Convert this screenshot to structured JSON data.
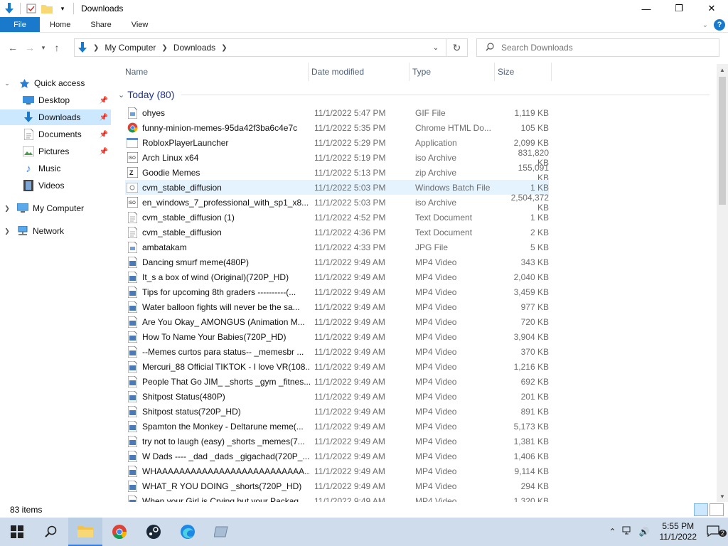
{
  "window": {
    "title": "Downloads",
    "controls": {
      "minimize": "—",
      "maximize": "❐",
      "close": "✕"
    }
  },
  "ribbon": {
    "tabs": [
      "File",
      "Home",
      "Share",
      "View"
    ],
    "help": "?"
  },
  "address": {
    "crumbs": [
      "My Computer",
      "Downloads"
    ],
    "search_placeholder": "Search Downloads"
  },
  "nav": {
    "items": [
      {
        "label": "Quick access",
        "icon": "star-icon",
        "expand": "v",
        "indent": 0,
        "pinned": false
      },
      {
        "label": "Desktop",
        "icon": "desktop-icon",
        "indent": 1,
        "pinned": true
      },
      {
        "label": "Downloads",
        "icon": "download-arrow-icon",
        "indent": 1,
        "pinned": true,
        "selected": true
      },
      {
        "label": "Documents",
        "icon": "document-icon",
        "indent": 1,
        "pinned": true
      },
      {
        "label": "Pictures",
        "icon": "pictures-icon",
        "indent": 1,
        "pinned": true
      },
      {
        "label": "Music",
        "icon": "music-icon",
        "indent": 1,
        "pinned": false
      },
      {
        "label": "Videos",
        "icon": "videos-icon",
        "indent": 1,
        "pinned": false
      },
      {
        "label": "My Computer",
        "icon": "computer-icon",
        "expand": ">",
        "indent": 0,
        "pinned": false
      },
      {
        "label": "Network",
        "icon": "network-icon",
        "expand": ">",
        "indent": 0,
        "pinned": false
      }
    ]
  },
  "columns": {
    "name": "Name",
    "date": "Date modified",
    "type": "Type",
    "size": "Size"
  },
  "group": {
    "label": "Today (80)"
  },
  "files": [
    {
      "name": "ohyes",
      "date": "11/1/2022 5:47 PM",
      "type": "GIF File",
      "size": "1,119 KB",
      "icon": "image-file-icon"
    },
    {
      "name": "funny-minion-memes-95da42f3ba6c4e7c",
      "date": "11/1/2022 5:35 PM",
      "type": "Chrome HTML Do...",
      "size": "105 KB",
      "icon": "chrome-icon"
    },
    {
      "name": "RobloxPlayerLauncher",
      "date": "11/1/2022 5:29 PM",
      "type": "Application",
      "size": "2,099 KB",
      "icon": "application-icon"
    },
    {
      "name": "Arch Linux x64",
      "date": "11/1/2022 5:19 PM",
      "type": "iso Archive",
      "size": "831,820 KB",
      "icon": "iso-archive-icon"
    },
    {
      "name": "Goodie Memes",
      "date": "11/1/2022 5:13 PM",
      "type": "zip Archive",
      "size": "155,091 KB",
      "icon": "zip-archive-icon"
    },
    {
      "name": "cvm_stable_diffusion",
      "date": "11/1/2022 5:03 PM",
      "type": "Windows Batch File",
      "size": "1 KB",
      "icon": "batch-file-icon",
      "hover": true
    },
    {
      "name": "en_windows_7_professional_with_sp1_x8...",
      "date": "11/1/2022 5:03 PM",
      "type": "iso Archive",
      "size": "2,504,372 KB",
      "icon": "iso-archive-icon"
    },
    {
      "name": "cvm_stable_diffusion (1)",
      "date": "11/1/2022 4:52 PM",
      "type": "Text Document",
      "size": "1 KB",
      "icon": "text-file-icon"
    },
    {
      "name": "cvm_stable_diffusion",
      "date": "11/1/2022 4:36 PM",
      "type": "Text Document",
      "size": "2 KB",
      "icon": "text-file-icon"
    },
    {
      "name": "ambatakam",
      "date": "11/1/2022 4:33 PM",
      "type": "JPG File",
      "size": "5 KB",
      "icon": "image-file-icon"
    },
    {
      "name": "Dancing smurf meme(480P)",
      "date": "11/1/2022 9:49 AM",
      "type": "MP4 Video",
      "size": "343 KB",
      "icon": "video-file-icon"
    },
    {
      "name": "It_s a box of wind (Original)(720P_HD)",
      "date": "11/1/2022 9:49 AM",
      "type": "MP4 Video",
      "size": "2,040 KB",
      "icon": "video-file-icon"
    },
    {
      "name": "Tips for upcoming 8th graders ----------(...",
      "date": "11/1/2022 9:49 AM",
      "type": "MP4 Video",
      "size": "3,459 KB",
      "icon": "video-file-icon"
    },
    {
      "name": "Water balloon fights will never be the sa...",
      "date": "11/1/2022 9:49 AM",
      "type": "MP4 Video",
      "size": "977 KB",
      "icon": "video-file-icon"
    },
    {
      "name": "Are You Okay_ AMONGUS (Animation M...",
      "date": "11/1/2022 9:49 AM",
      "type": "MP4 Video",
      "size": "720 KB",
      "icon": "video-file-icon"
    },
    {
      "name": "How To Name Your Babies(720P_HD)",
      "date": "11/1/2022 9:49 AM",
      "type": "MP4 Video",
      "size": "3,904 KB",
      "icon": "video-file-icon"
    },
    {
      "name": "--Memes curtos para status-- _memesbr ...",
      "date": "11/1/2022 9:49 AM",
      "type": "MP4 Video",
      "size": "370 KB",
      "icon": "video-file-icon"
    },
    {
      "name": "Mercuri_88 Official TIKTOK - I love VR(108...",
      "date": "11/1/2022 9:49 AM",
      "type": "MP4 Video",
      "size": "1,216 KB",
      "icon": "video-file-icon"
    },
    {
      "name": "People That Go JIM_ _shorts _gym _fitnes...",
      "date": "11/1/2022 9:49 AM",
      "type": "MP4 Video",
      "size": "692 KB",
      "icon": "video-file-icon"
    },
    {
      "name": "Shitpost Status(480P)",
      "date": "11/1/2022 9:49 AM",
      "type": "MP4 Video",
      "size": "201 KB",
      "icon": "video-file-icon"
    },
    {
      "name": "Shitpost status(720P_HD)",
      "date": "11/1/2022 9:49 AM",
      "type": "MP4 Video",
      "size": "891 KB",
      "icon": "video-file-icon"
    },
    {
      "name": "Spamton the Monkey - Deltarune meme(...",
      "date": "11/1/2022 9:49 AM",
      "type": "MP4 Video",
      "size": "5,173 KB",
      "icon": "video-file-icon"
    },
    {
      "name": "try not to laugh (easy) _shorts _memes(7...",
      "date": "11/1/2022 9:49 AM",
      "type": "MP4 Video",
      "size": "1,381 KB",
      "icon": "video-file-icon"
    },
    {
      "name": "W Dads ---- _dad _dads _gigachad(720P_...",
      "date": "11/1/2022 9:49 AM",
      "type": "MP4 Video",
      "size": "1,406 KB",
      "icon": "video-file-icon"
    },
    {
      "name": "WHAAAAAAAAAAAAAAAAAAAAAAAAAA...",
      "date": "11/1/2022 9:49 AM",
      "type": "MP4 Video",
      "size": "9,114 KB",
      "icon": "video-file-icon"
    },
    {
      "name": "WHAT_R YOU DOING _shorts(720P_HD)",
      "date": "11/1/2022 9:49 AM",
      "type": "MP4 Video",
      "size": "294 KB",
      "icon": "video-file-icon"
    },
    {
      "name": "When your Girl is Crying but your Packag...",
      "date": "11/1/2022 9:49 AM",
      "type": "MP4 Video",
      "size": "1,320 KB",
      "icon": "video-file-icon"
    }
  ],
  "status": {
    "items": "83 items"
  },
  "taskbar": {
    "apps": [
      "start-icon",
      "search-icon",
      "file-explorer-icon",
      "chrome-icon",
      "steam-icon",
      "edge-icon",
      "app-icon"
    ],
    "time": "5:55 PM",
    "date": "11/1/2022",
    "notifications": "2"
  },
  "colors": {
    "accent": "#1979ca",
    "selected": "#cce8ff",
    "hover": "#e5f3ff",
    "group_text": "#1e3287",
    "taskbar": "#cfdceb"
  }
}
